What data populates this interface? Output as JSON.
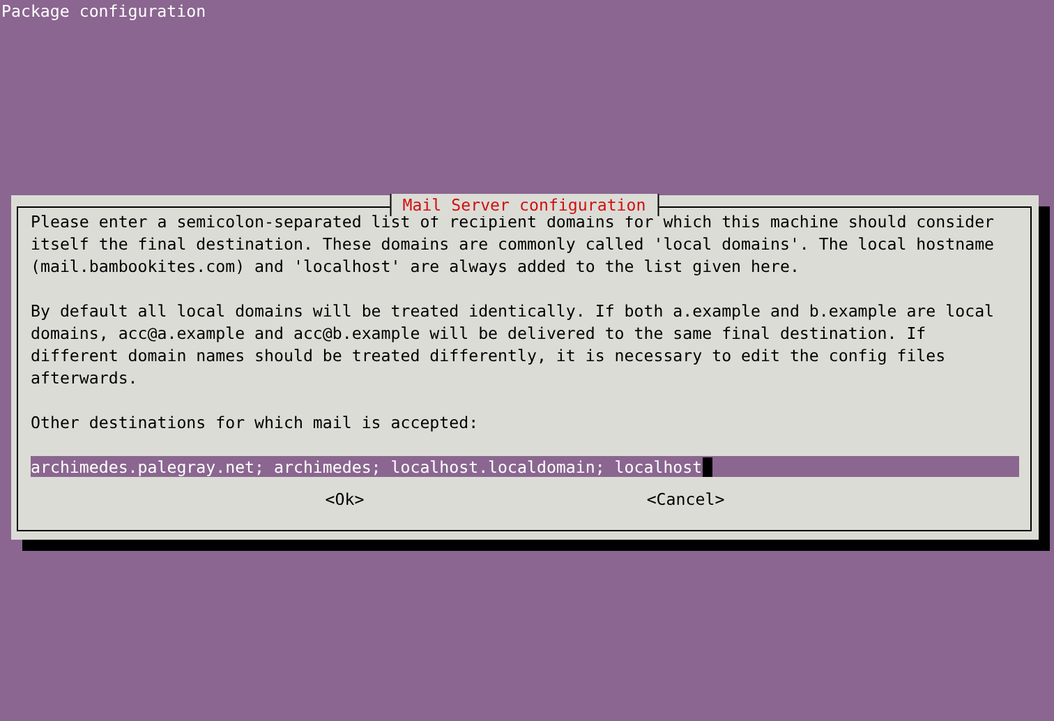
{
  "screen_title": "Package configuration",
  "dialog": {
    "title": "Mail Server configuration",
    "paragraphs": [
      "Please enter a semicolon-separated list of recipient domains for which this machine should consider itself the final destination. These domains are commonly called 'local domains'. The local hostname (mail.bambookites.com) and 'localhost' are always added to the list given here.",
      "By default all local domains will be treated identically. If both a.example and b.example are local domains, acc@a.example and acc@b.example will be delivered to the same final destination. If different domain names should be treated differently, it is necessary to edit the config files afterwards."
    ],
    "prompt": "Other destinations for which mail is accepted:",
    "input": {
      "value": "archimedes.palegray.net; archimedes; localhost.localdomain; localhost",
      "focused": true
    },
    "buttons": [
      {
        "label": "<Ok>",
        "selected": false
      },
      {
        "label": "<Cancel>",
        "selected": false
      }
    ]
  }
}
